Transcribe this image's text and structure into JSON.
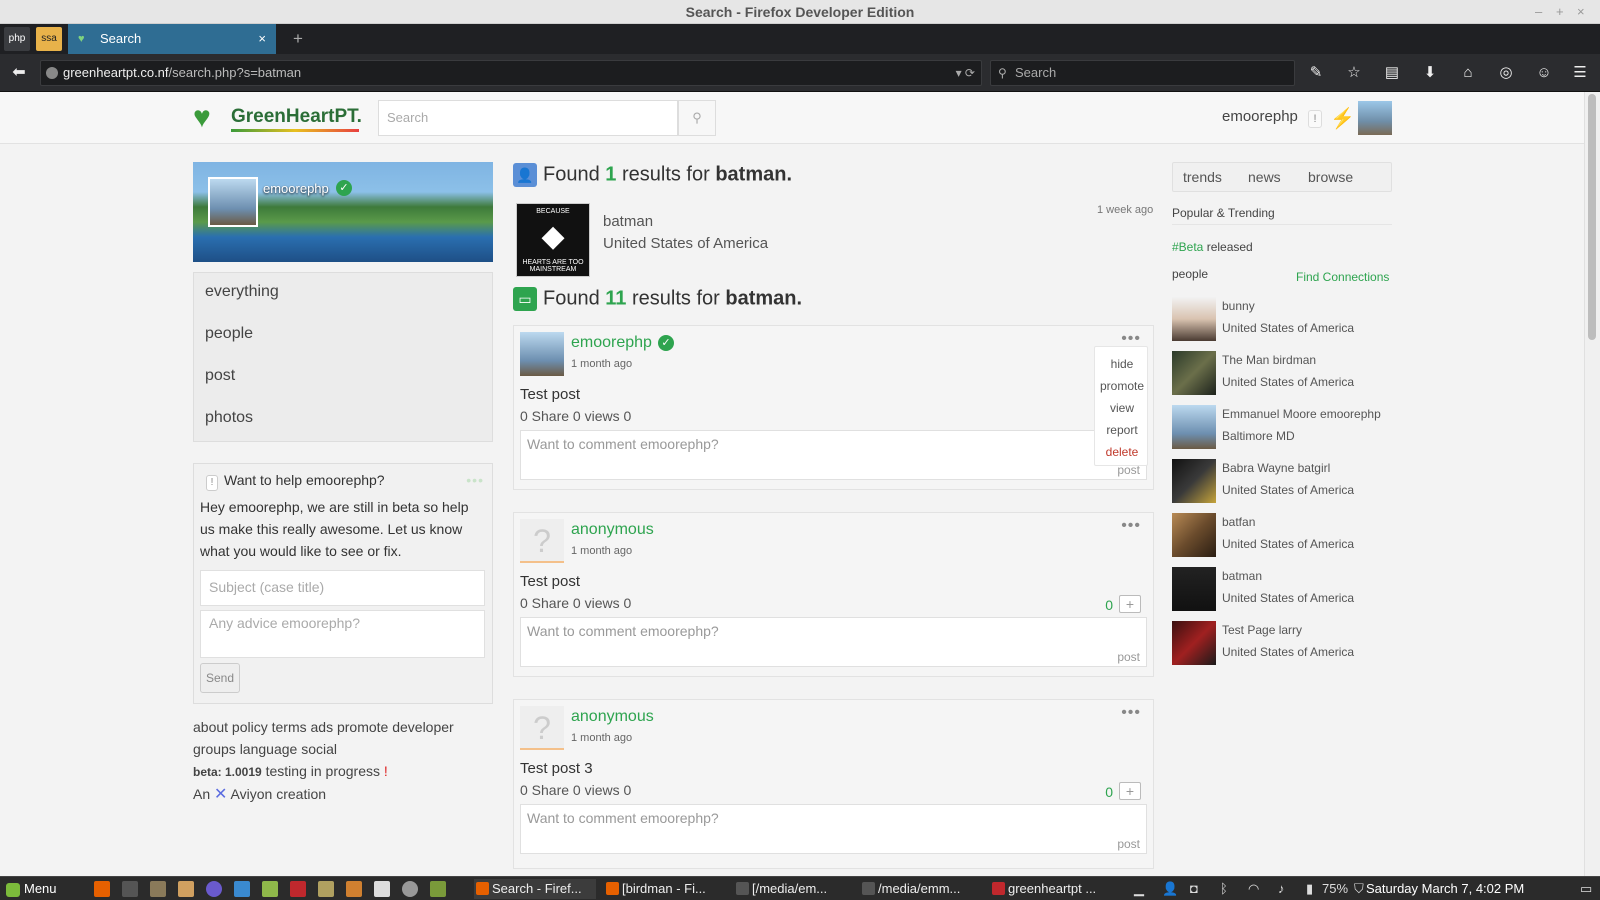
{
  "window": {
    "title": "Search - Firefox Developer Edition",
    "min": "–",
    "max": "+",
    "close": "×"
  },
  "browser": {
    "pinned": [
      "php",
      "ssa"
    ],
    "tab_title": "Search",
    "tab_close": "×",
    "new_tab": "+",
    "url_host": "greenheartpt.co.nf",
    "url_path": "/search.php?s=batman",
    "search_placeholder": "Search"
  },
  "site": {
    "logo": "GreenHeartPT.",
    "search_placeholder": "Search",
    "username": "emoorephp",
    "notif": "!"
  },
  "left": {
    "cover_name": "emoorephp",
    "nav": [
      "everything",
      "people",
      "post",
      "photos"
    ],
    "help_title": "Want to help emoorephp?",
    "help_msg": "Hey emoorephp, we are still in beta so help us make this really awesome. Let us know what you would like to see or fix.",
    "subject_placeholder": "Subject (case title)",
    "advice_placeholder": "Any advice emoorephp?",
    "send": "Send",
    "footer_links": "about policy terms ads promote developer groups language social",
    "beta_label": "beta: 1.0019",
    "beta_text": "testing in progress",
    "beta_bang": "!",
    "creation_a": "An",
    "creation_b": "Aviyon creation"
  },
  "results": {
    "people": {
      "prefix": "Found",
      "count": "1",
      "mid": "results for",
      "term": "batman."
    },
    "person": {
      "name": "batman",
      "location": "United States of America",
      "ago": "1 week ago",
      "thumb_top": "BECAUSE",
      "thumb_bottom": "HEARTS ARE TOO MAINSTREAM"
    },
    "posts": {
      "prefix": "Found",
      "count": "11",
      "mid": "results for",
      "term": "batman."
    },
    "items": [
      {
        "author": "emoorephp",
        "ago": "1 month ago",
        "title": "Test post",
        "stats": "0 Share 0 views 0",
        "placeholder": "Want to comment emoorephp?",
        "post": "post",
        "count": ""
      },
      {
        "author": "anonymous",
        "ago": "1 month ago",
        "title": "Test post",
        "stats": "0 Share 0 views 0",
        "placeholder": "Want to comment emoorephp?",
        "post": "post",
        "count": "0"
      },
      {
        "author": "anonymous",
        "ago": "1 month ago",
        "title": "Test post 3",
        "stats": "0 Share 0 views 0",
        "placeholder": "Want to comment emoorephp?",
        "post": "post",
        "count": "0"
      }
    ],
    "menu": [
      "hide",
      "promote",
      "view",
      "report",
      "delete"
    ]
  },
  "right": {
    "tabs": [
      "trends",
      "news",
      "browse"
    ],
    "popular": "Popular & Trending",
    "beta_tag": "#Beta",
    "beta_rest": "released",
    "people_label": "people",
    "find": "Find Connections",
    "people": [
      {
        "name": "bunny",
        "loc": "United States of America"
      },
      {
        "name": "The Man birdman",
        "loc": "United States of America"
      },
      {
        "name": "Emmanuel Moore emoorephp",
        "loc": "Baltimore MD"
      },
      {
        "name": "Babra Wayne batgirl",
        "loc": "United States of America"
      },
      {
        "name": "batfan",
        "loc": "United States of America"
      },
      {
        "name": "batman",
        "loc": "United States of America"
      },
      {
        "name": "Test Page larry",
        "loc": "United States of America"
      }
    ]
  },
  "taskbar": {
    "menu": "Menu",
    "tasks": [
      "Search - Firef...",
      "[birdman - Fi...",
      "[/media/em...",
      "/media/emm...",
      "greenheartpt ..."
    ],
    "battery": "75%",
    "clock": "Saturday March  7,  4:02 PM"
  }
}
